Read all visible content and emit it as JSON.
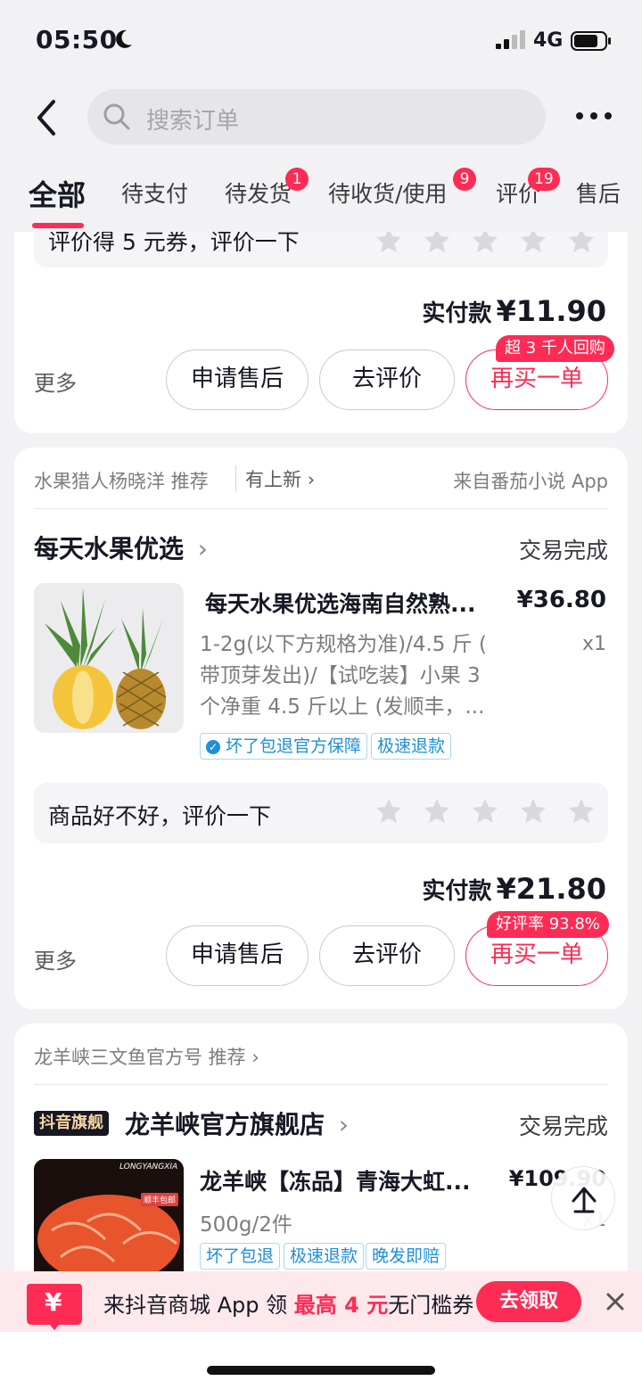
{
  "status_bar": {
    "time": "05:50",
    "network": "4G"
  },
  "search": {
    "placeholder": "搜索订单"
  },
  "tabs": [
    {
      "label": "全部",
      "active": true
    },
    {
      "label": "待支付"
    },
    {
      "label": "待发货",
      "badge": "1"
    },
    {
      "label": "待收货/使用",
      "badge": "9"
    },
    {
      "label": "评价",
      "badge": "19"
    },
    {
      "label": "售后"
    }
  ],
  "order1": {
    "rating_text": "评价得 5 元券，评价一下",
    "pay_label": "实付款",
    "pay_amount": "¥11.90",
    "more": "更多",
    "btn_after_sale": "申请售后",
    "btn_review": "去评价",
    "btn_rebuy": "再买一单",
    "rebuy_tip": "超 3 千人回购"
  },
  "order2": {
    "recommend": "水果猎人杨晓洋 推荐",
    "new_link": "有上新",
    "source": "来自番茄小说 App",
    "shop_name": "每天水果优选",
    "status": "交易完成",
    "product_title": "每天水果优选海南自然熟...",
    "price": "¥36.80",
    "spec": [
      "1-2g(以下方规格为准)/4.5 斤 (",
      "带顶芽发出)/【试吃装】小果 3",
      "个净重 4.5 斤以上 (发顺丰，..."
    ],
    "qty": "x1",
    "tag1": "坏了包退官方保障",
    "tag2": "极速退款",
    "rating_text": "商品好不好，评价一下",
    "pay_label": "实付款",
    "pay_amount": "¥21.80",
    "more": "更多",
    "btn_after_sale": "申请售后",
    "btn_review": "去评价",
    "btn_rebuy": "再买一单",
    "rebuy_tip": "好评率 93.8%"
  },
  "order3": {
    "recommend": "龙羊峡三文鱼官方号 推荐",
    "shop_badge": "抖音旗舰",
    "shop_name": "龙羊峡官方旗舰店",
    "status": "交易完成",
    "product_title": "龙羊峡【冻品】青海大虹...",
    "price": "¥109.90",
    "spec": "500g/2件",
    "qty": "x1",
    "tag1": "坏了包退",
    "tag2": "极速退款",
    "tag3": "晚发即赔",
    "thumb_brand": "LONGYANGXIA",
    "thumb_badge": "顺丰包邮"
  },
  "banner": {
    "text_a": "来抖音商城 App 领 ",
    "text_highlight": "最高 4 元",
    "text_b": "无门槛券",
    "button": "去领取",
    "coupon_symbol": "¥"
  },
  "colors": {
    "accent": "#fe2c55",
    "tag_blue": "#1e8fd9",
    "background": "#f2f2f4"
  }
}
